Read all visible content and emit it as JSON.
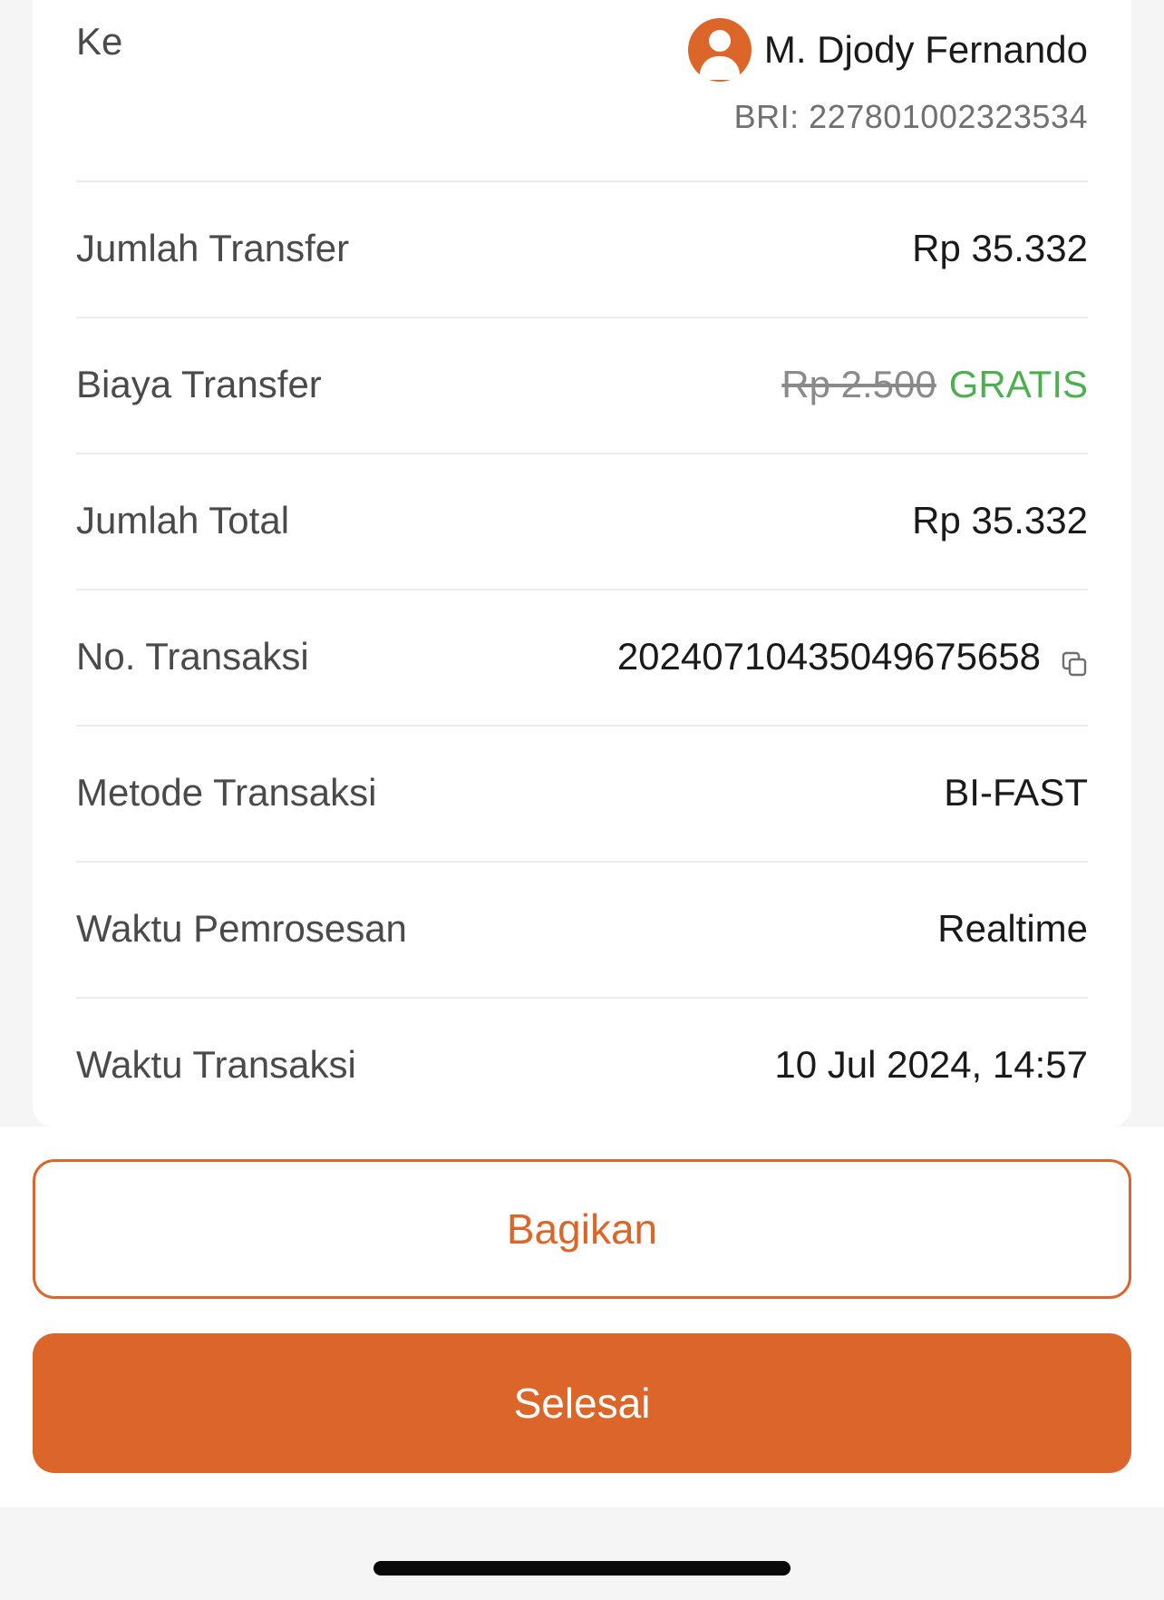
{
  "recipient": {
    "label": "Ke",
    "name": "M. Djody Fernando",
    "account": "BRI: 227801002323534"
  },
  "rows": [
    {
      "label": "Jumlah Transfer",
      "value": "Rp 35.332"
    },
    {
      "label": "Biaya Transfer",
      "original_value": "Rp 2.500",
      "value": "GRATIS"
    },
    {
      "label": "Jumlah Total",
      "value": "Rp 35.332"
    },
    {
      "label": "No. Transaksi",
      "value": "20240710435049675658"
    },
    {
      "label": "Metode Transaksi",
      "value": "BI-FAST"
    },
    {
      "label": "Waktu Pemrosesan",
      "value": "Realtime"
    },
    {
      "label": "Waktu Transaksi",
      "value": "10 Jul 2024, 14:57"
    }
  ],
  "buttons": {
    "share_label": "Bagikan",
    "done_label": "Selesai"
  },
  "colors": {
    "accent": "#dc6629",
    "free": "#4caf50",
    "background": "#f5f5f6"
  },
  "icons": {
    "avatar": "user-avatar-icon",
    "copy": "copy-icon"
  }
}
